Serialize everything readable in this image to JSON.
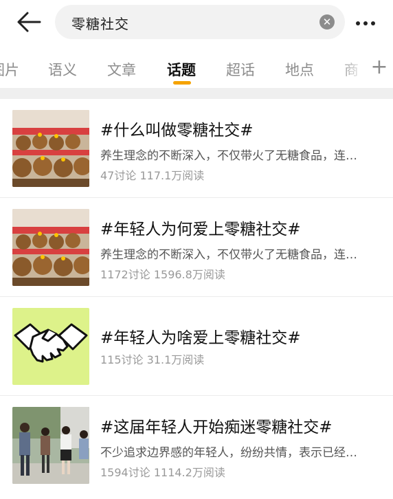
{
  "search": {
    "query": "零糖社交",
    "clear_icon": "close-icon"
  },
  "tabs": [
    {
      "label": "图片"
    },
    {
      "label": "语义"
    },
    {
      "label": "文章"
    },
    {
      "label": "话题"
    },
    {
      "label": "超话"
    },
    {
      "label": "地点"
    },
    {
      "label": "商"
    }
  ],
  "active_tab": "话题",
  "accent_color": "#f5a300",
  "topics": [
    {
      "title": "#什么叫做零糖社交#",
      "desc": "养生理念的不断深入，不仅带火了无糖食品，连…",
      "discussions": "47讨论",
      "reads": "117.1万阅读",
      "thumb_icon": "capybara-plush-photo"
    },
    {
      "title": "#年轻人为何爱上零糖社交#",
      "desc": "养生理念的不断深入，不仅带火了无糖食品，连…",
      "discussions": "1172讨论",
      "reads": "1596.8万阅读",
      "thumb_icon": "capybara-plush-photo"
    },
    {
      "title": "#年轻人为啥爱上零糖社交#",
      "desc": "",
      "discussions": "115讨论",
      "reads": "31.1万阅读",
      "thumb_icon": "handshake-icon"
    },
    {
      "title": "#这届年轻人开始痴迷零糖社交#",
      "desc": "不少追求边界感的年轻人，纷纷共情，表示已经…",
      "discussions": "1594讨论",
      "reads": "1114.2万阅读",
      "thumb_icon": "people-street-photo"
    }
  ]
}
